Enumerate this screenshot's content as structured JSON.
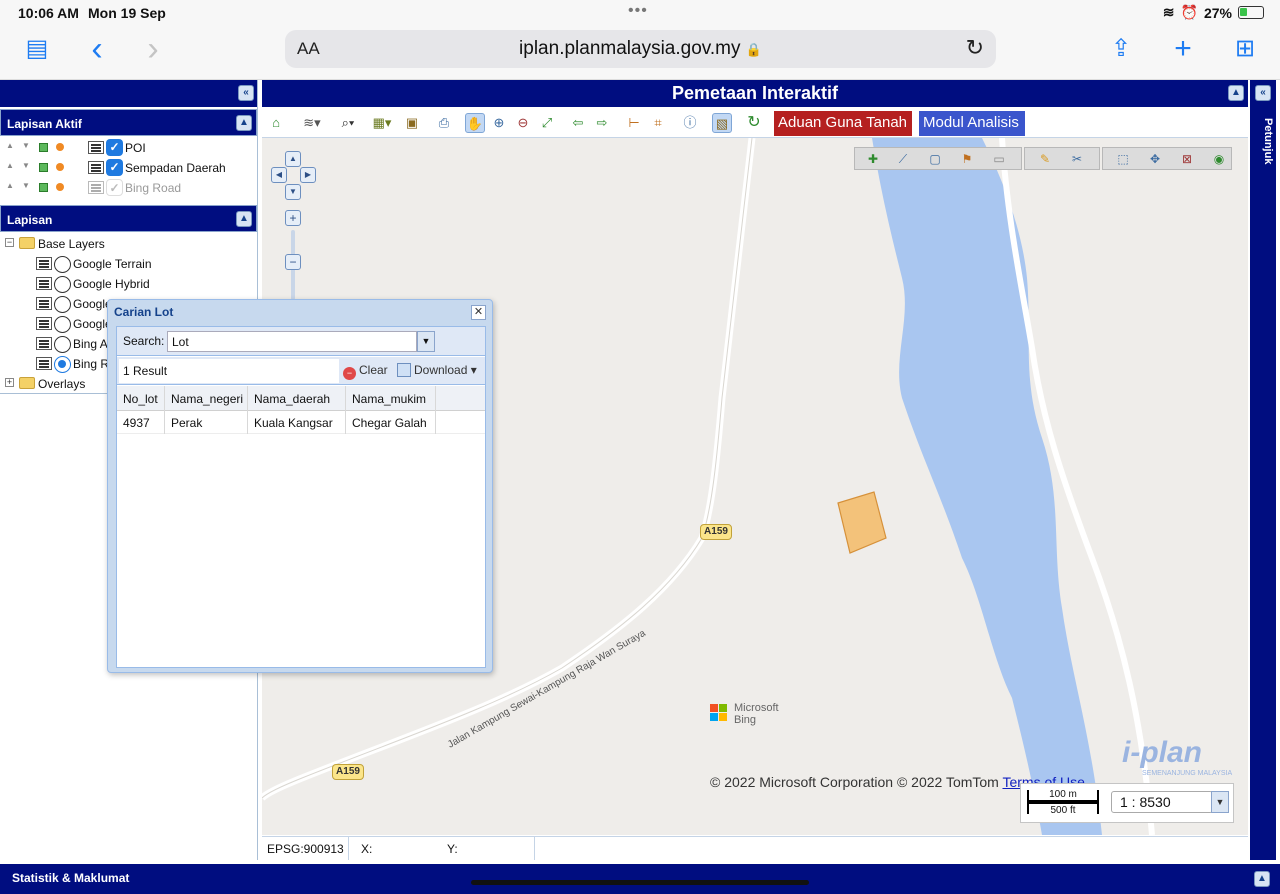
{
  "ios": {
    "time": "10:06 AM",
    "date": "Mon 19 Sep",
    "battery": "27%",
    "ellipsis": "•••"
  },
  "safari": {
    "text_size": "AA",
    "url": "iplan.planmalaysia.gov.my",
    "lock": "🔒",
    "reload": "↻",
    "sidebar_icon": "▤",
    "back_icon": "‹",
    "forward_icon": "›",
    "share_icon": "⇪",
    "add_icon": "+",
    "tabs_icon": "⊞"
  },
  "left_panel": {
    "lapisan_aktif": {
      "title": "Lapisan Aktif",
      "layers": [
        {
          "label": "POI",
          "checked": true
        },
        {
          "label": "Sempadan Daerah",
          "checked": true
        },
        {
          "label": "Bing Road",
          "checked": false
        }
      ]
    },
    "lapisan": {
      "title": "Lapisan",
      "base_layers_label": "Base Layers",
      "base_layers": [
        {
          "label": "Google Terrain",
          "selected": false
        },
        {
          "label": "Google Hybrid",
          "selected": false
        },
        {
          "label": "Google Satellite",
          "selected": false
        },
        {
          "label": "Google",
          "selected": false
        },
        {
          "label": "Bing A",
          "selected": false
        },
        {
          "label": "Bing R",
          "selected": true
        }
      ],
      "overlays_label": "Overlays"
    }
  },
  "main": {
    "title": "Pemetaan Interaktif",
    "buttons": {
      "aduan": "Aduan Guna Tanah",
      "modul": "Modul Analisis"
    },
    "coords": {
      "epsg": "EPSG:900913",
      "x_label": "X:",
      "y_label": "Y:"
    },
    "attribution": "© 2022 Microsoft Corporation © 2022 TomTom ",
    "terms": "Terms of Use",
    "scale_bar_m": "100 m",
    "scale_bar_ft": "500 ft",
    "scale_ratio": "1 : 8530",
    "bing_logo": [
      "Microsoft",
      "Bing"
    ],
    "iplan_logo": "i-plan",
    "iplan_sub": "SEMENANJUNG MALAYSIA",
    "roads": {
      "shield_a": "A159",
      "shield_b": "A159",
      "road_label": "Jalan Kampung Sewai-Kampung Raja Wan Suraya"
    }
  },
  "right_panel": {
    "title": "Petunjuk"
  },
  "bottom": {
    "title": "Statistik & Maklumat"
  },
  "dialog": {
    "title": "Carian Lot",
    "search_label": "Search:",
    "search_value": "Lot",
    "result_text": "1 Result",
    "clear_label": "Clear",
    "download_label": "Download",
    "columns": [
      "No_lot",
      "Nama_negeri",
      "Nama_daerah",
      "Nama_mukim"
    ],
    "rows": [
      [
        "4937",
        "Perak",
        "Kuala Kangsar",
        "Chegar Galah"
      ]
    ]
  },
  "colors": {
    "navy": "#000d80",
    "aduan_red": "#b52020",
    "modul_blue": "#3a55cc",
    "river": "#a9c6f0",
    "parcel": "#f3c27a"
  }
}
